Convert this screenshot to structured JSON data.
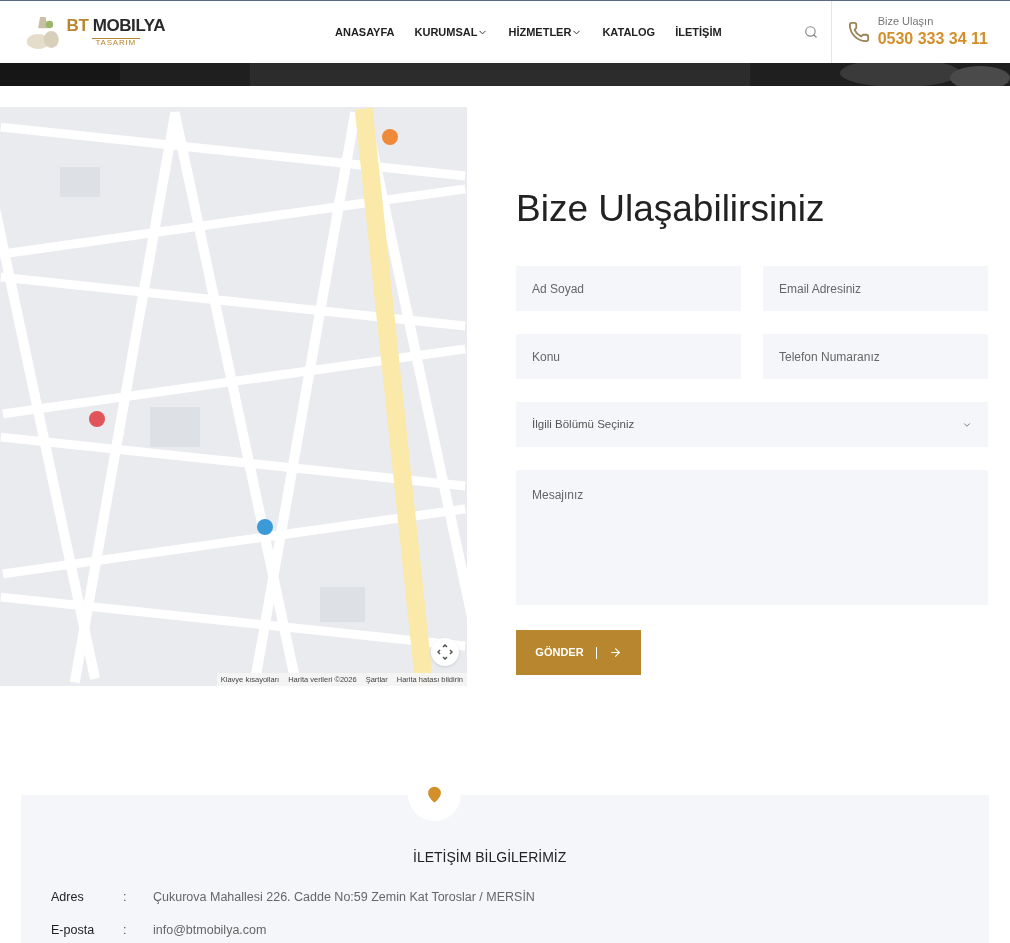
{
  "header": {
    "logo": {
      "brand_accent": "BT",
      "brand": "MOBILYA",
      "tagline": "TASARIM"
    },
    "nav": [
      {
        "label": "ANASAYFA",
        "dropdown": false
      },
      {
        "label": "KURUMSAL",
        "dropdown": true
      },
      {
        "label": "HİZMETLER",
        "dropdown": true
      },
      {
        "label": "KATALOG",
        "dropdown": false
      },
      {
        "label": "İLETİŞİM",
        "dropdown": false
      }
    ],
    "contact": {
      "label": "Bize Ulaşın",
      "phone": "0530 333 34 11"
    }
  },
  "map": {
    "attribution": [
      "Klavye kısayolları",
      "Harita verileri ©2026",
      "Şartlar",
      "Harita hatası bildirin"
    ]
  },
  "form": {
    "title": "Bize Ulaşabilirsiniz",
    "fields": [
      {
        "kind": "input",
        "placeholder": "Ad Soyad"
      },
      {
        "kind": "input",
        "placeholder": "Email Adresiniz"
      },
      {
        "kind": "input",
        "placeholder": "Konu"
      },
      {
        "kind": "input",
        "placeholder": "Telefon Numaranız"
      },
      {
        "kind": "select",
        "placeholder": "İlgili Bölümü Seçiniz"
      },
      {
        "kind": "textarea",
        "placeholder": "Mesajınız"
      }
    ],
    "submit": "GÖNDER"
  },
  "info": {
    "title": "İLETİŞİM BİLGİLERİMİZ",
    "rows": [
      {
        "label": "Adres",
        "separator": ":",
        "value": "Çukurova Mahallesi 226. Cadde No:59 Zemin Kat Toroslar / MERSİN"
      },
      {
        "label": "E-posta",
        "separator": ":",
        "value": "info@btmobilya.com"
      }
    ]
  }
}
